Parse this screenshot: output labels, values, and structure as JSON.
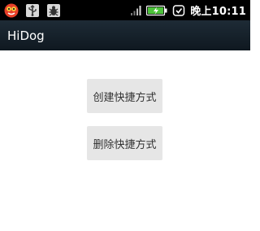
{
  "status_bar": {
    "time": "晚上10:11",
    "icons": [
      "hidog-app-icon",
      "usb-icon",
      "debug-bug-icon",
      "signal-icon",
      "battery-charging-icon",
      "alarm-icon"
    ],
    "colors": {
      "background": "#000000",
      "text": "#ffffff",
      "battery": "#4cc23a"
    }
  },
  "action_bar": {
    "title": "HiDog",
    "colors": {
      "background": "#16212a",
      "text": "#ffffff"
    }
  },
  "main": {
    "create_shortcut_label": "创建快捷方式",
    "delete_shortcut_label": "删除快捷方式",
    "colors": {
      "button_bg": "#e6e6e6",
      "button_text": "#333333"
    }
  }
}
